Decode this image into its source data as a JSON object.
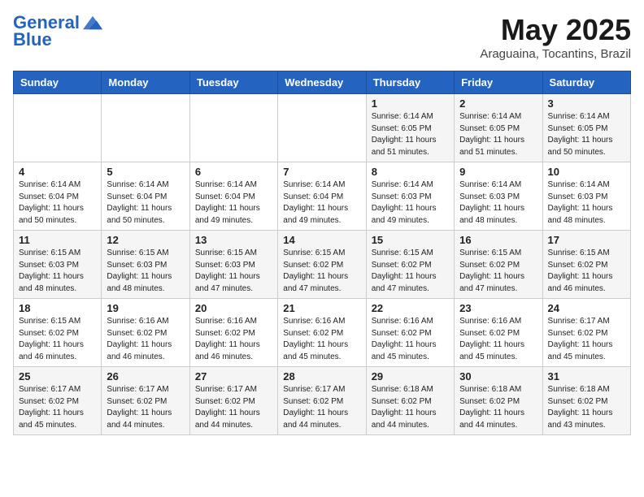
{
  "logo": {
    "line1": "General",
    "line2": "Blue"
  },
  "title": "May 2025",
  "location": "Araguaina, Tocantins, Brazil",
  "days_of_week": [
    "Sunday",
    "Monday",
    "Tuesday",
    "Wednesday",
    "Thursday",
    "Friday",
    "Saturday"
  ],
  "weeks": [
    [
      {
        "day": "",
        "info": ""
      },
      {
        "day": "",
        "info": ""
      },
      {
        "day": "",
        "info": ""
      },
      {
        "day": "",
        "info": ""
      },
      {
        "day": "1",
        "sunrise": "6:14 AM",
        "sunset": "6:05 PM",
        "daylight": "11 hours and 51 minutes."
      },
      {
        "day": "2",
        "sunrise": "6:14 AM",
        "sunset": "6:05 PM",
        "daylight": "11 hours and 51 minutes."
      },
      {
        "day": "3",
        "sunrise": "6:14 AM",
        "sunset": "6:05 PM",
        "daylight": "11 hours and 50 minutes."
      }
    ],
    [
      {
        "day": "4",
        "sunrise": "6:14 AM",
        "sunset": "6:04 PM",
        "daylight": "11 hours and 50 minutes."
      },
      {
        "day": "5",
        "sunrise": "6:14 AM",
        "sunset": "6:04 PM",
        "daylight": "11 hours and 50 minutes."
      },
      {
        "day": "6",
        "sunrise": "6:14 AM",
        "sunset": "6:04 PM",
        "daylight": "11 hours and 49 minutes."
      },
      {
        "day": "7",
        "sunrise": "6:14 AM",
        "sunset": "6:04 PM",
        "daylight": "11 hours and 49 minutes."
      },
      {
        "day": "8",
        "sunrise": "6:14 AM",
        "sunset": "6:03 PM",
        "daylight": "11 hours and 49 minutes."
      },
      {
        "day": "9",
        "sunrise": "6:14 AM",
        "sunset": "6:03 PM",
        "daylight": "11 hours and 48 minutes."
      },
      {
        "day": "10",
        "sunrise": "6:14 AM",
        "sunset": "6:03 PM",
        "daylight": "11 hours and 48 minutes."
      }
    ],
    [
      {
        "day": "11",
        "sunrise": "6:15 AM",
        "sunset": "6:03 PM",
        "daylight": "11 hours and 48 minutes."
      },
      {
        "day": "12",
        "sunrise": "6:15 AM",
        "sunset": "6:03 PM",
        "daylight": "11 hours and 48 minutes."
      },
      {
        "day": "13",
        "sunrise": "6:15 AM",
        "sunset": "6:03 PM",
        "daylight": "11 hours and 47 minutes."
      },
      {
        "day": "14",
        "sunrise": "6:15 AM",
        "sunset": "6:02 PM",
        "daylight": "11 hours and 47 minutes."
      },
      {
        "day": "15",
        "sunrise": "6:15 AM",
        "sunset": "6:02 PM",
        "daylight": "11 hours and 47 minutes."
      },
      {
        "day": "16",
        "sunrise": "6:15 AM",
        "sunset": "6:02 PM",
        "daylight": "11 hours and 47 minutes."
      },
      {
        "day": "17",
        "sunrise": "6:15 AM",
        "sunset": "6:02 PM",
        "daylight": "11 hours and 46 minutes."
      }
    ],
    [
      {
        "day": "18",
        "sunrise": "6:15 AM",
        "sunset": "6:02 PM",
        "daylight": "11 hours and 46 minutes."
      },
      {
        "day": "19",
        "sunrise": "6:16 AM",
        "sunset": "6:02 PM",
        "daylight": "11 hours and 46 minutes."
      },
      {
        "day": "20",
        "sunrise": "6:16 AM",
        "sunset": "6:02 PM",
        "daylight": "11 hours and 46 minutes."
      },
      {
        "day": "21",
        "sunrise": "6:16 AM",
        "sunset": "6:02 PM",
        "daylight": "11 hours and 45 minutes."
      },
      {
        "day": "22",
        "sunrise": "6:16 AM",
        "sunset": "6:02 PM",
        "daylight": "11 hours and 45 minutes."
      },
      {
        "day": "23",
        "sunrise": "6:16 AM",
        "sunset": "6:02 PM",
        "daylight": "11 hours and 45 minutes."
      },
      {
        "day": "24",
        "sunrise": "6:17 AM",
        "sunset": "6:02 PM",
        "daylight": "11 hours and 45 minutes."
      }
    ],
    [
      {
        "day": "25",
        "sunrise": "6:17 AM",
        "sunset": "6:02 PM",
        "daylight": "11 hours and 45 minutes."
      },
      {
        "day": "26",
        "sunrise": "6:17 AM",
        "sunset": "6:02 PM",
        "daylight": "11 hours and 44 minutes."
      },
      {
        "day": "27",
        "sunrise": "6:17 AM",
        "sunset": "6:02 PM",
        "daylight": "11 hours and 44 minutes."
      },
      {
        "day": "28",
        "sunrise": "6:17 AM",
        "sunset": "6:02 PM",
        "daylight": "11 hours and 44 minutes."
      },
      {
        "day": "29",
        "sunrise": "6:18 AM",
        "sunset": "6:02 PM",
        "daylight": "11 hours and 44 minutes."
      },
      {
        "day": "30",
        "sunrise": "6:18 AM",
        "sunset": "6:02 PM",
        "daylight": "11 hours and 44 minutes."
      },
      {
        "day": "31",
        "sunrise": "6:18 AM",
        "sunset": "6:02 PM",
        "daylight": "11 hours and 43 minutes."
      }
    ]
  ]
}
